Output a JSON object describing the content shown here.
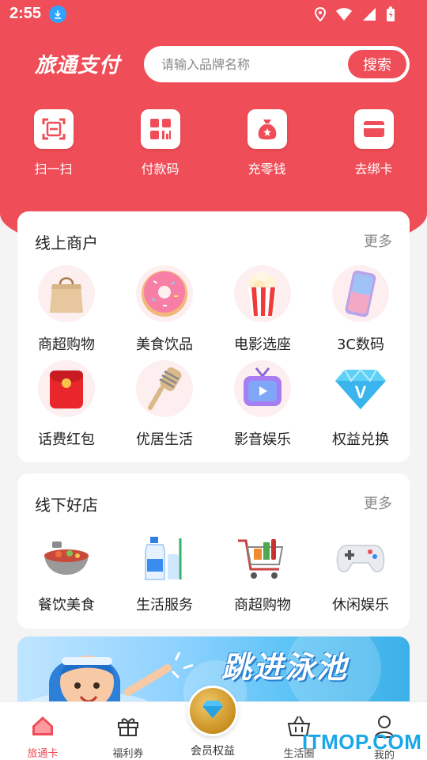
{
  "status_bar": {
    "time": "2:55"
  },
  "header": {
    "brand": "旅通支付",
    "search_placeholder": "请输入品牌名称",
    "search_button": "搜索"
  },
  "quick_actions": [
    {
      "label": "扫一扫",
      "icon": "scan-icon"
    },
    {
      "label": "付款码",
      "icon": "payment-code-icon"
    },
    {
      "label": "充零钱",
      "icon": "money-bag-icon"
    },
    {
      "label": "去绑卡",
      "icon": "card-icon"
    }
  ],
  "online": {
    "title": "线上商户",
    "more": "更多",
    "items": [
      {
        "label": "商超购物",
        "icon": "shopping-bag-icon"
      },
      {
        "label": "美食饮品",
        "icon": "donut-icon"
      },
      {
        "label": "电影选座",
        "icon": "popcorn-icon"
      },
      {
        "label": "3C数码",
        "icon": "phone-icon"
      },
      {
        "label": "话费红包",
        "icon": "red-packet-icon"
      },
      {
        "label": "优居生活",
        "icon": "brush-icon"
      },
      {
        "label": "影音娱乐",
        "icon": "tv-icon"
      },
      {
        "label": "权益兑换",
        "icon": "diamond-icon"
      }
    ]
  },
  "offline": {
    "title": "线下好店",
    "more": "更多",
    "items": [
      {
        "label": "餐饮美食",
        "icon": "hotpot-icon"
      },
      {
        "label": "生活服务",
        "icon": "detergent-icon"
      },
      {
        "label": "商超购物",
        "icon": "cart-icon"
      },
      {
        "label": "休闲娱乐",
        "icon": "gamepad-icon"
      }
    ]
  },
  "banner": {
    "text": "跳进泳池"
  },
  "tabbar": {
    "items": [
      {
        "label": "旅通卡",
        "active": true
      },
      {
        "label": "福利券"
      },
      {
        "label": "会员权益"
      },
      {
        "label": "生活圈"
      },
      {
        "label": "我的"
      }
    ]
  },
  "watermark": "ITMOP.COM",
  "colors": {
    "primary": "#ef4d57",
    "background": "#f4f4f4",
    "card": "#ffffff"
  }
}
